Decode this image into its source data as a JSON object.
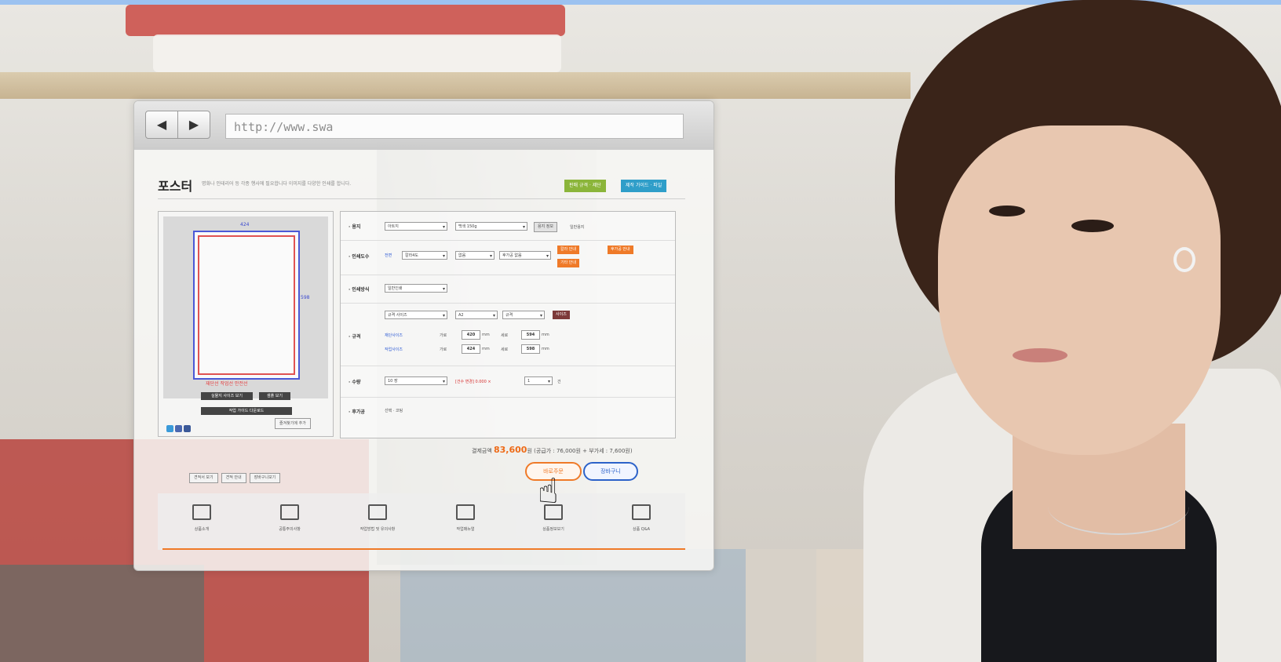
{
  "browser": {
    "url": "http://www.swa",
    "back_icon": "◀",
    "forward_icon": "▶"
  },
  "page": {
    "title": "포스터",
    "description": "명화나 인테리어 등 각종 행사에 필요합니다 이미지를 다양한 인쇄를 합니다.",
    "badges": [
      "판매 규격 · 제단",
      "제작 가이드 · 파일"
    ]
  },
  "preview": {
    "dim_width": "424",
    "dim_height": "598",
    "legend": "재단선 작업선 안전선",
    "buttons": [
      "실물지 사이즈 보기",
      "샘플 보기",
      "작업 가이드 다운로드"
    ],
    "favorite_label": "즐겨찾기에 추가"
  },
  "options": {
    "rows": [
      {
        "label": "· 용지",
        "selects": [
          "아트지",
          "백색 150g"
        ],
        "extra": "용지 정보",
        "note": "일반용지"
      },
      {
        "label": "· 인쇄도수",
        "prefix": "전면",
        "selects": [
          "칼라4도",
          "없음",
          "후가공 없음"
        ],
        "buttons": [
          "칼라 안내",
          "후가공 안내",
          "기타 안내"
        ]
      },
      {
        "label": "· 인쇄방식",
        "selects": [
          "일반인쇄"
        ]
      },
      {
        "label": "· 규격",
        "selects": [
          "규격 사이즈",
          "A2",
          "규격"
        ],
        "dark_btn": "사이즈",
        "work_size_label": "재단사이즈",
        "cut_size_label": "작업사이즈",
        "w1": "420",
        "h1": "594",
        "w2": "424",
        "h2": "598",
        "unit": "mm",
        "w_label": "가로",
        "h_label": "세로"
      },
      {
        "label": "· 수량",
        "selects": [
          "10 장"
        ],
        "note": "[건수 변경] 0.000 ×",
        "count": "1",
        "count_unit": "건"
      },
      {
        "label": "· 후가공",
        "note": "선택 · 코팅"
      }
    ]
  },
  "order": {
    "total_label": "결제금액",
    "total_amount": "83,600",
    "total_unit": "원 (공급가 : 76,000원 + 부가세 : 7,600원)",
    "order_button": "바로주문",
    "cart_button": "장바구니"
  },
  "links": [
    "견적서 보기",
    "견적 안내",
    "장바구니보기"
  ],
  "bottom_nav": [
    {
      "label": "상품소개",
      "icon": "cart-icon"
    },
    {
      "label": "공통주의사항",
      "icon": "check-icon"
    },
    {
      "label": "작업방법 및 유의사항",
      "icon": "calendar-icon"
    },
    {
      "label": "작업매뉴얼",
      "icon": "download-icon"
    },
    {
      "label": "상품정보보기",
      "icon": "info-icon"
    },
    {
      "label": "상품 Q&A",
      "icon": "edit-icon"
    }
  ],
  "colors": {
    "accent_orange": "#ef7a28",
    "accent_blue": "#2c62c9",
    "top_bar": "#9cc2f0"
  }
}
